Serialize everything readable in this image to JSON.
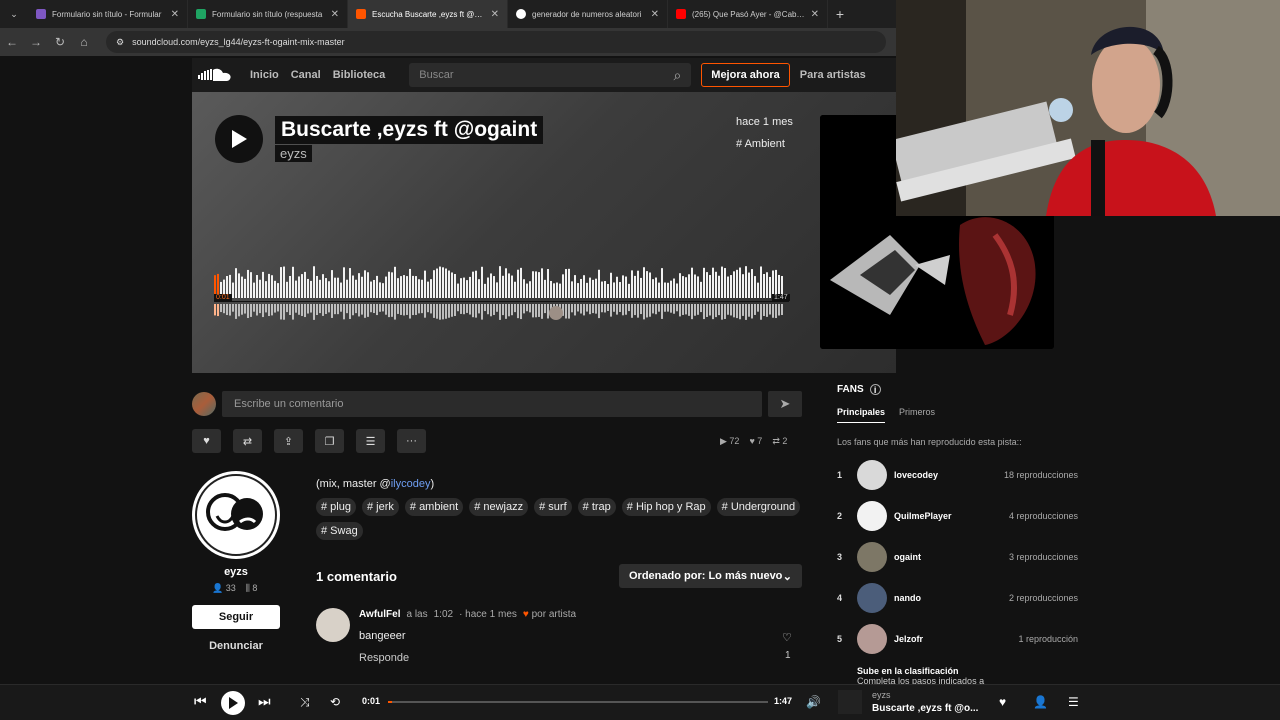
{
  "browser": {
    "tabs": [
      {
        "label": "Formulario sin título - Formular",
        "color": "#7e57c2",
        "active": false
      },
      {
        "label": "Formulario sin título (respuesta",
        "color": "#1fa463",
        "active": false
      },
      {
        "label": "Escucha Buscarte ,eyzs ft @oga",
        "color": "#ff5500",
        "active": true
      },
      {
        "label": "generador de numeros aleatori",
        "color": "#ffffff",
        "active": false
      },
      {
        "label": "(265) Que Pasó Ayer - @Cabxo",
        "color": "#ff0000",
        "active": false
      }
    ],
    "url": "soundcloud.com/eyzs_lg44/eyzs-ft-ogaint-mix-master"
  },
  "header": {
    "nav": [
      "Inicio",
      "Canal",
      "Biblioteca"
    ],
    "search_placeholder": "Buscar",
    "upgrade_label": "Mejora ahora",
    "artists_label": "Para artistas"
  },
  "track": {
    "title": "Buscarte ,eyzs ft @ogaint",
    "artist": "eyzs",
    "posted": "hace 1 mes",
    "genre_tag": "# Ambient",
    "time_current": "0:01",
    "time_total": "1:47",
    "progress": 0.01
  },
  "comment_box": {
    "placeholder": "Escribe un comentario"
  },
  "stats": {
    "plays": "72",
    "likes": "7",
    "reposts": "2"
  },
  "profile": {
    "name": "eyzs",
    "followers": "33",
    "tracks": "8",
    "follow_label": "Seguir",
    "report_label": "Denunciar"
  },
  "description": {
    "prefix": "(mix, master @",
    "mention": "ilycodey",
    "suffix": ")"
  },
  "tags": [
    "# plug",
    "# jerk",
    "# ambient",
    "# newjazz",
    "# surf",
    "# trap",
    "# Hip hop y Rap",
    "# Underground",
    "# Swag"
  ],
  "comments": {
    "heading": "1 comentario",
    "sort_label": "Ordenado por: Lo más nuevo",
    "items": [
      {
        "user": "AwfulFel",
        "at_label": "a las",
        "at_time": "1:02",
        "when": "· hace 1 mes",
        "by_artist": "por artista",
        "text": "bangeeer",
        "reply": "Responde",
        "likes": "1"
      }
    ]
  },
  "fans": {
    "heading": "FANS",
    "tab_top": "Principales",
    "tab_first": "Primeros",
    "subtitle": "Los fans que más han reproducido esta pista::",
    "list": [
      {
        "rank": "1",
        "name": "lovecodey",
        "plays": "18 reproducciones",
        "color": "#d9d9d9"
      },
      {
        "rank": "2",
        "name": "QuilmePlayer",
        "plays": "4 reproducciones",
        "color": "#f2f2f2"
      },
      {
        "rank": "3",
        "name": "ogaint",
        "plays": "3 reproducciones",
        "color": "#7d7766"
      },
      {
        "rank": "4",
        "name": "nando",
        "plays": "2 reproducciones",
        "color": "#4b5d7a"
      },
      {
        "rank": "5",
        "name": "Jelzofr",
        "plays": "1 reproducción",
        "color": "#b59a95"
      }
    ],
    "climb_title": "Sube en la clasificación",
    "climb_text": "Completa los pasos indicados a"
  },
  "player": {
    "artist": "eyzs",
    "track": "Buscarte ,eyzs ft @o..."
  },
  "colors": {
    "accent": "#ff5500",
    "mention": "#6f9ff3"
  }
}
